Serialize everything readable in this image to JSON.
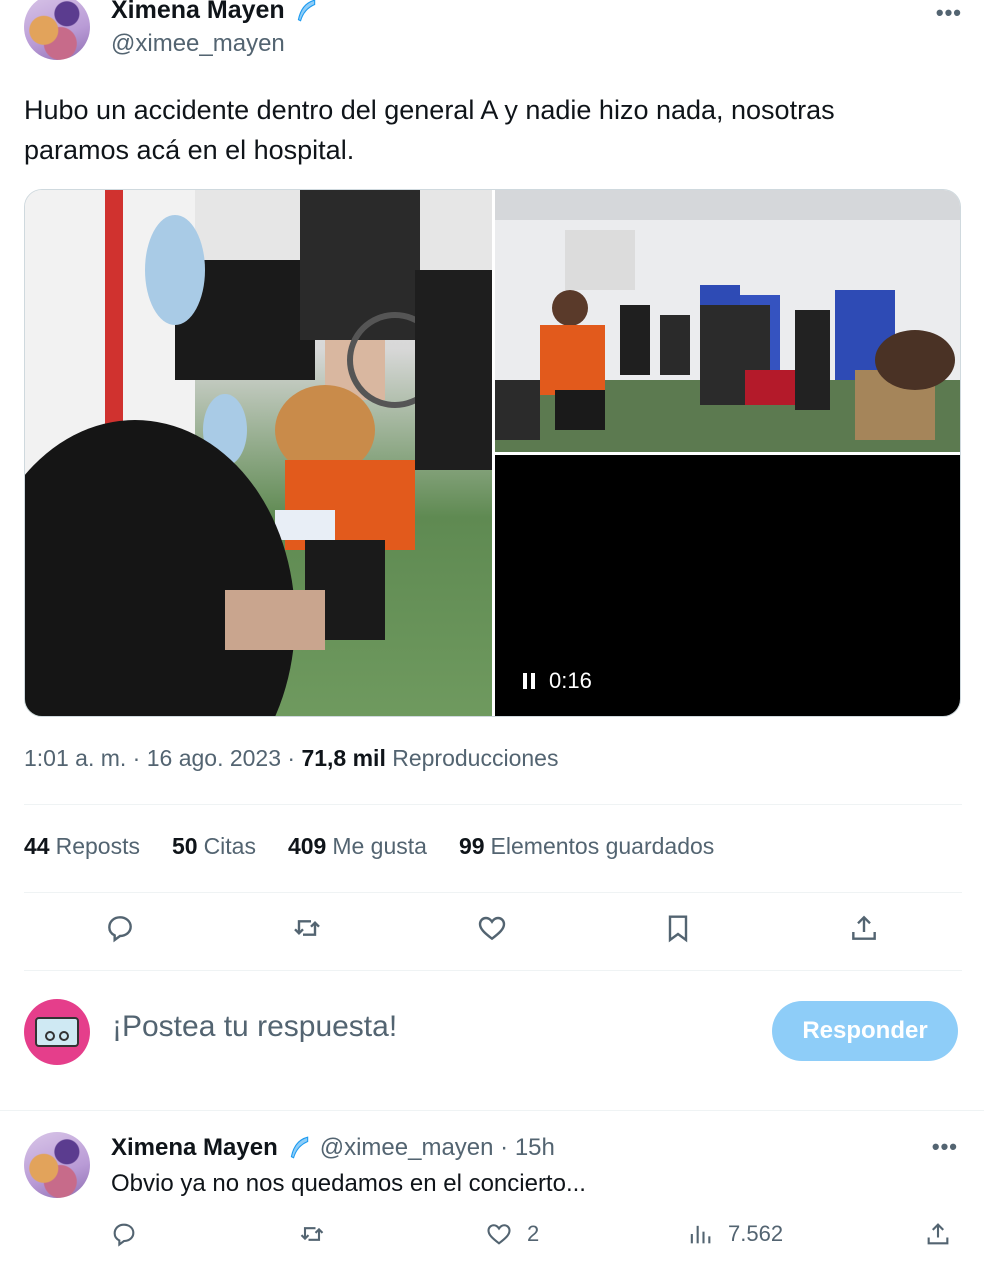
{
  "tweet": {
    "author_name": "Ximena Mayen",
    "author_handle": "@ximee_mayen",
    "text": "Hubo un accidente dentro del general A y nadie hizo nada, nosotras paramos acá en el hospital.",
    "video_duration": "0:16",
    "timestamp": "1:01 a. m. · 16 ago. 2023 · ",
    "views_count": "71,8 mil",
    "views_label": " Reproducciones"
  },
  "stats": [
    {
      "count": "44",
      "label": "Reposts"
    },
    {
      "count": "50",
      "label": "Citas"
    },
    {
      "count": "409",
      "label": "Me gusta"
    },
    {
      "count": "99",
      "label": "Elementos guardados"
    }
  ],
  "composer": {
    "placeholder": "¡Postea tu respuesta!",
    "button_label": "Responder"
  },
  "reply": {
    "author_name": "Ximena Mayen",
    "meta": "@ximee_mayen · 15h",
    "text": "Obvio ya no nos quedamos en el concierto...",
    "likes": "2",
    "views": "7.562"
  },
  "icons": {
    "verified": "feather-badge-icon",
    "more": "more-icon",
    "reply": "reply-icon",
    "repost": "repost-icon",
    "like": "heart-icon",
    "bookmark": "bookmark-icon",
    "share": "share-icon",
    "views": "views-icon",
    "pause": "pause-icon"
  },
  "colors": {
    "primary_text": "#0f1419",
    "secondary_text": "#536471",
    "button_disabled": "#8ecdf8",
    "divider": "#eff3f4",
    "verified": "#1d9bf0"
  }
}
